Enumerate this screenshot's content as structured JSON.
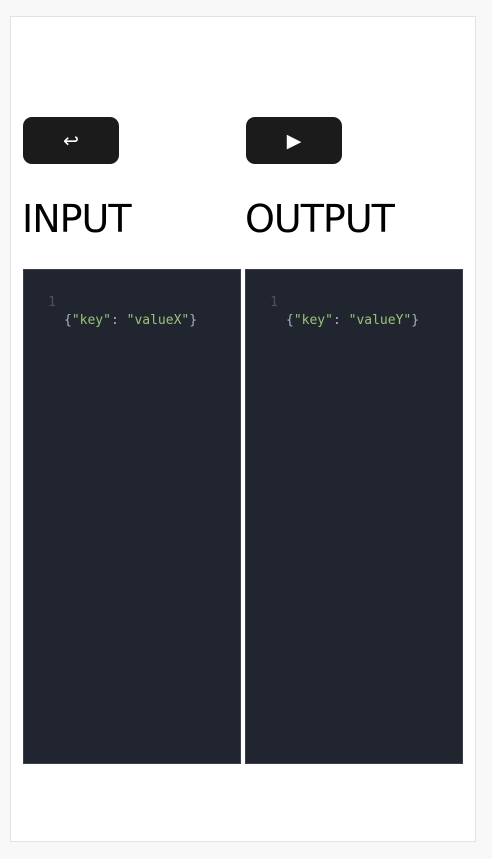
{
  "toolbar": {
    "reset_icon_glyph": "↩",
    "run_icon_glyph": "▶"
  },
  "panels": {
    "input": {
      "title": "INPUT",
      "line_number": "1",
      "code": {
        "open": "{",
        "key": "\"key\"",
        "sep": ": ",
        "value": "\"valueX\"",
        "close": "}"
      }
    },
    "output": {
      "title": "OUTPUT",
      "line_number": "1",
      "code": {
        "open": "{",
        "key": "\"key\"",
        "sep": ": ",
        "value": "\"valueY\"",
        "close": "}"
      }
    }
  },
  "colors": {
    "editor_background": "#21252f",
    "string_token": "#98c379",
    "punctuation": "#abb2bf",
    "gutter_text": "#4b5263",
    "button_background": "#1b1b1b"
  }
}
